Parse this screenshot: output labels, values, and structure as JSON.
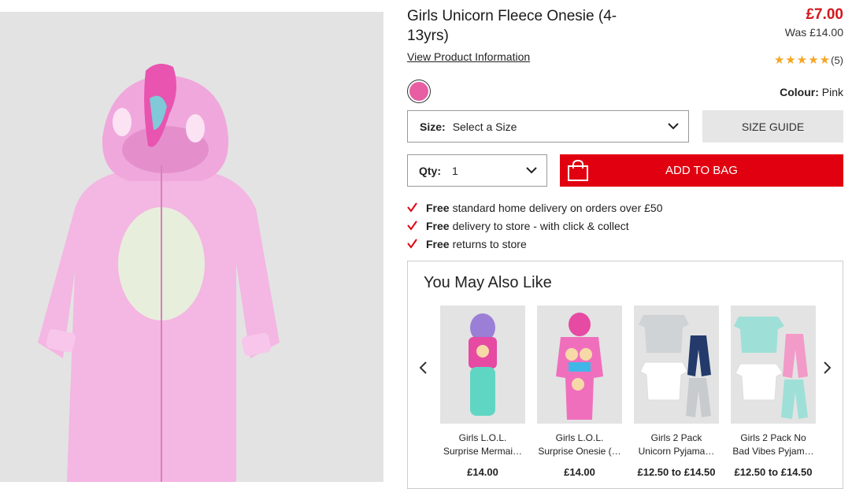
{
  "product": {
    "title": "Girls Unicorn Fleece Onesie (4-13yrs)",
    "price": "£7.00",
    "was_price": "Was £14.00",
    "info_link": "View Product Information",
    "rating_stars": 5,
    "review_count": "(5)",
    "colour_label": "Colour:",
    "colour_value": "Pink",
    "swatch_color": "#e75ea3"
  },
  "size": {
    "label": "Size:",
    "value": "Select a Size",
    "guide": "SIZE GUIDE"
  },
  "qty": {
    "label": "Qty:",
    "value": "1"
  },
  "add_to_bag": "ADD TO BAG",
  "perks": [
    {
      "bold": "Free",
      "text": "standard home delivery on orders over £50"
    },
    {
      "bold": "Free",
      "text": "delivery to store - with click & collect"
    },
    {
      "bold": "Free",
      "text": "returns to store"
    }
  ],
  "recommendations": {
    "title": "You May Also Like",
    "items": [
      {
        "name1": "Girls L.O.L.",
        "name2": "Surprise Mermai…",
        "price": "£14.00"
      },
      {
        "name1": "Girls L.O.L.",
        "name2": "Surprise Onesie (…",
        "price": "£14.00"
      },
      {
        "name1": "Girls 2 Pack",
        "name2": "Unicorn Pyjama…",
        "price": "£12.50 to £14.50"
      },
      {
        "name1": "Girls 2 Pack No",
        "name2": "Bad Vibes Pyjam…",
        "price": "£12.50 to £14.50"
      }
    ]
  },
  "colors": {
    "accent_red": "#e1000f",
    "price_red": "#d3161b",
    "star": "#f5a623"
  }
}
